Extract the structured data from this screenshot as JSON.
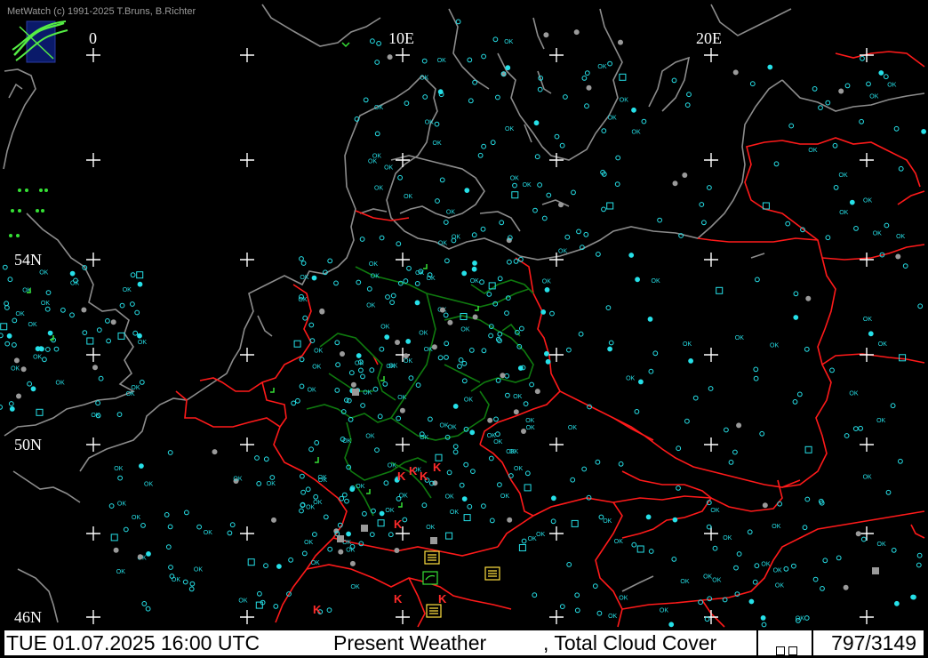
{
  "app": {
    "credit": "MetWatch  (c) 1991-2025 T.Bruns, B.Richter"
  },
  "grid": {
    "lon_labels": [
      "0",
      "10E",
      "20E"
    ],
    "lat_labels": [
      "54N",
      "50N",
      "46N"
    ]
  },
  "status": {
    "datetime": "TUE 01.07.2025 16:00 UTC",
    "product": "Present Weather",
    "cloud": ", Total Cloud Cover",
    "count": "797/3149"
  },
  "colors": {
    "coast": "#8c8c8c",
    "borders": "#ff1a1a",
    "admin": "#0f7a0f",
    "station": "#26e0e8",
    "grey_station": "#9a9a9a",
    "green_symbol": "#35e035",
    "red_symbol": "#ff2a2a",
    "yellow_symbol": "#ffe040"
  },
  "legend": {
    "ok_text": "OK",
    "thunder_text": "K"
  }
}
